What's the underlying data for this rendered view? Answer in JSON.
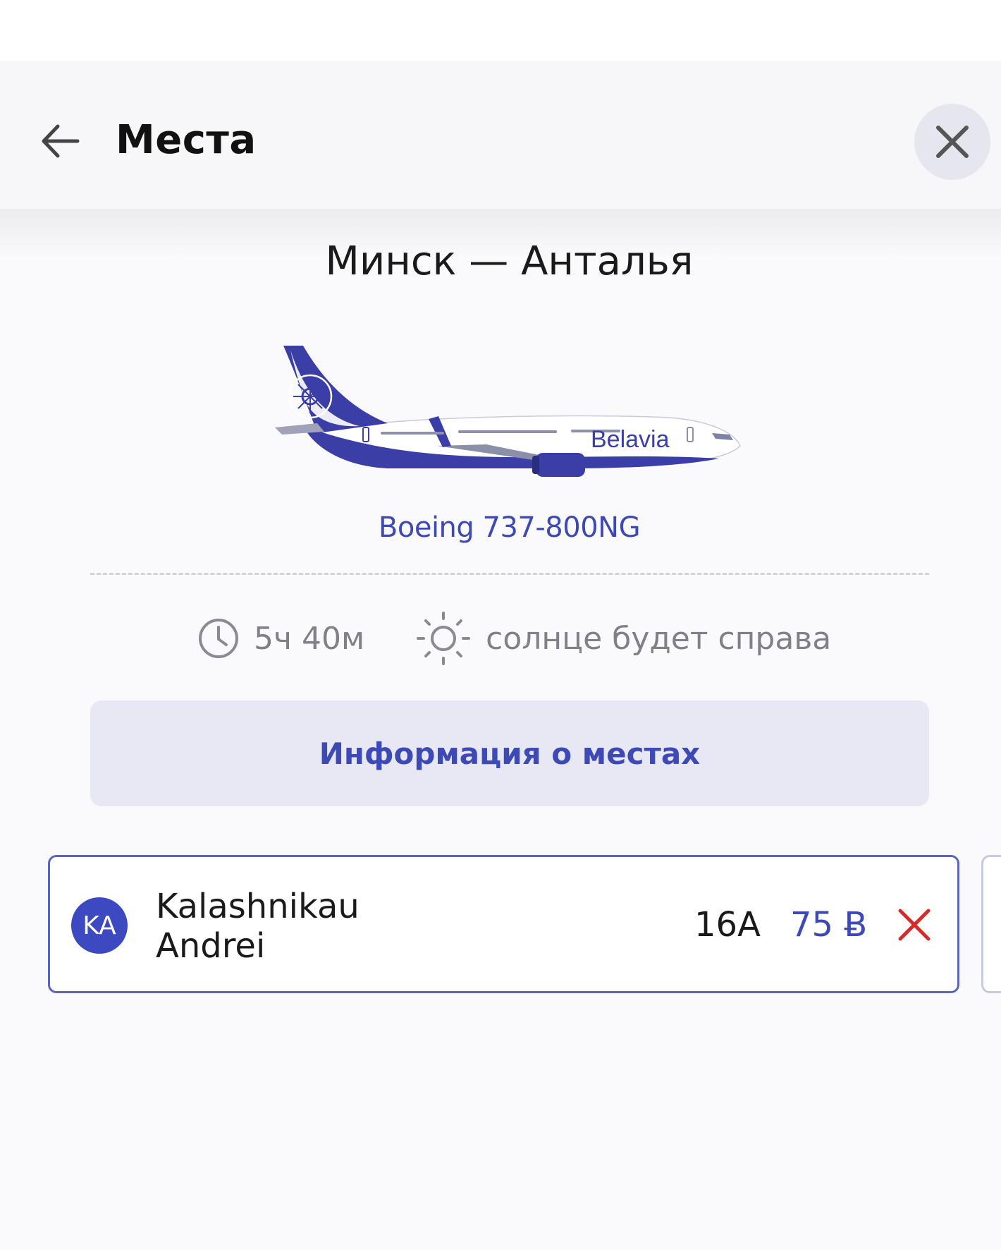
{
  "header": {
    "title": "Места",
    "back_icon": "arrow-left-icon",
    "close_icon": "close-icon"
  },
  "flight": {
    "route": "Минск — Анталья",
    "aircraft": "Boeing 737-800NG",
    "airline_logo_text": "Belavia",
    "duration": "5ч 40м",
    "sun_side": "солнце будет справа"
  },
  "seat_info_button": "Информация о местах",
  "passenger": {
    "initials": "KA",
    "last_name": "Kalashnikau",
    "first_name": "Andrei",
    "seat": "16A",
    "price": "75 Ƀ"
  },
  "colors": {
    "accent": "#3d49b5",
    "remove": "#d62b2b",
    "info_button_bg": "#e7e8f4"
  }
}
